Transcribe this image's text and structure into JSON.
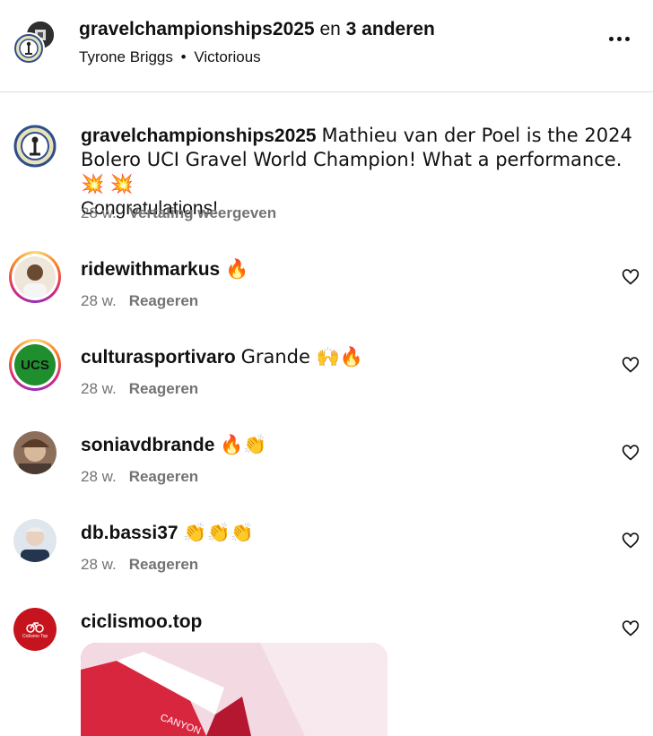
{
  "header": {
    "owner": "gravelchampionships2025",
    "joiner": "en",
    "others": "3 anderen",
    "sub_author": "Tyrone Briggs",
    "sub_separator": "•",
    "sub_audio": "Victorious"
  },
  "caption": {
    "user": "gravelchampionships2025",
    "text": "Mathieu van der Poel is the 2024 Bolero UCI Gravel World Champion! What a performance. 💥 💥",
    "text2": "Congratulations!",
    "time": "28 w.",
    "action": "Vertaling weergeven"
  },
  "comments": [
    {
      "user": "ridewithmarkus",
      "text": "🔥",
      "time": "28 w.",
      "action": "Reageren"
    },
    {
      "user": "culturasportivaro",
      "text": "Grande 🙌🔥",
      "time": "28 w.",
      "action": "Reageren"
    },
    {
      "user": "soniavdbrande",
      "text": "🔥👏",
      "time": "28 w.",
      "action": "Reageren"
    },
    {
      "user": "db.bassi37",
      "text": "👏👏👏",
      "time": "28 w.",
      "action": "Reageren"
    },
    {
      "user": "ciclismoo.top",
      "text": "",
      "time": "",
      "action": ""
    }
  ],
  "avatars": {
    "ucs_text": "UCS",
    "ciclismoo_text": "Ciclismo Top"
  },
  "media": {
    "label": "CANYON"
  },
  "colors": {
    "text": "#111111",
    "secondary": "#737373",
    "divider": "#dbdbdb",
    "ucs_green": "#1f8f2e",
    "ciclismoo_red": "#c5141d"
  }
}
